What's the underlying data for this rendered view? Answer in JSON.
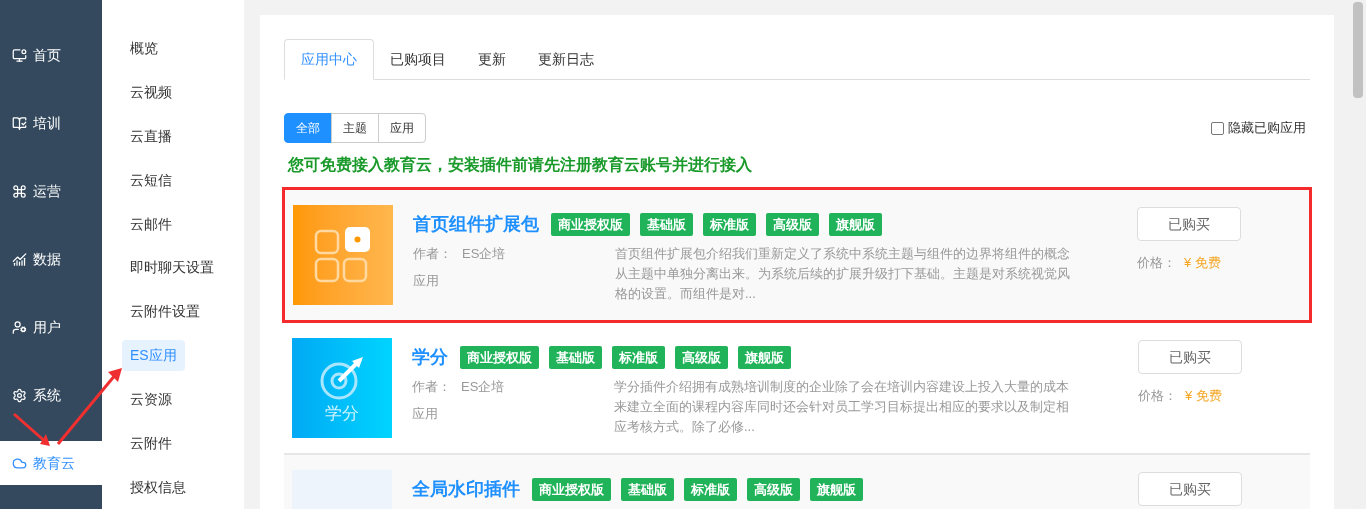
{
  "sidebar": {
    "items": [
      {
        "label": "首页",
        "kind": "monitor",
        "selected": false
      },
      {
        "label": "培训",
        "kind": "book",
        "selected": false
      },
      {
        "label": "运营",
        "kind": "command",
        "selected": false
      },
      {
        "label": "数据",
        "kind": "chart",
        "selected": false
      },
      {
        "label": "用户",
        "kind": "user",
        "selected": false
      },
      {
        "label": "系统",
        "kind": "gear",
        "selected": false
      },
      {
        "label": "教育云",
        "kind": "cloud",
        "selected": true
      }
    ]
  },
  "submenu": {
    "items": [
      {
        "label": "概览",
        "selected": false
      },
      {
        "label": "云视频",
        "selected": false
      },
      {
        "label": "云直播",
        "selected": false
      },
      {
        "label": "云短信",
        "selected": false
      },
      {
        "label": "云邮件",
        "selected": false
      },
      {
        "label": "即时聊天设置",
        "selected": false
      },
      {
        "label": "云附件设置",
        "selected": false
      },
      {
        "label": "ES应用",
        "selected": true
      },
      {
        "label": "云资源",
        "selected": false
      },
      {
        "label": "云附件",
        "selected": false
      },
      {
        "label": "授权信息",
        "selected": false
      }
    ]
  },
  "tabs": [
    {
      "label": "应用中心",
      "selected": true
    },
    {
      "label": "已购项目",
      "selected": false
    },
    {
      "label": "更新",
      "selected": false
    },
    {
      "label": "更新日志",
      "selected": false
    }
  ],
  "filters": [
    {
      "label": "全部",
      "selected": true
    },
    {
      "label": "主题",
      "selected": false
    },
    {
      "label": "应用",
      "selected": false
    }
  ],
  "hide_purchased": {
    "label": "隐藏已购应用",
    "checked": false
  },
  "notice": "您可免费接入教育云，安装插件前请先注册教育云账号并进行接入",
  "apps": [
    {
      "kind": "grid",
      "highlighted": true,
      "title": "首页组件扩展包",
      "tags": [
        "商业授权版",
        "基础版",
        "标准版",
        "高级版",
        "旗舰版"
      ],
      "author_label": "作者：",
      "author": "ES企培",
      "type": "应用",
      "description": "首页组件扩展包介绍我们重新定义了系统中系统主题与组件的边界将组件的概念从主题中单独分离出来。为系统后续的扩展升级打下基础。主题是对系统视觉风格的设置。而组件是对...",
      "button": "已购买",
      "price_label": "价格：",
      "price": "¥ 免费"
    },
    {
      "kind": "target",
      "highlighted": false,
      "thumb_text": "学分",
      "title": "学分",
      "tags": [
        "商业授权版",
        "基础版",
        "标准版",
        "高级版",
        "旗舰版"
      ],
      "author_label": "作者：",
      "author": "ES企培",
      "type": "应用",
      "description": "学分插件介绍拥有成熟培训制度的企业除了会在培训内容建设上投入大量的成本来建立全面的课程内容库同时还会针对员工学习目标提出相应的要求以及制定相应考核方式。除了必修...",
      "button": "已购买",
      "price_label": "价格：",
      "price": "¥ 免费"
    },
    {
      "kind": "blank",
      "highlighted": false,
      "title": "全局水印插件",
      "tags": [
        "商业授权版",
        "基础版",
        "标准版",
        "高级版",
        "旗舰版"
      ],
      "button": "已购买"
    }
  ]
}
